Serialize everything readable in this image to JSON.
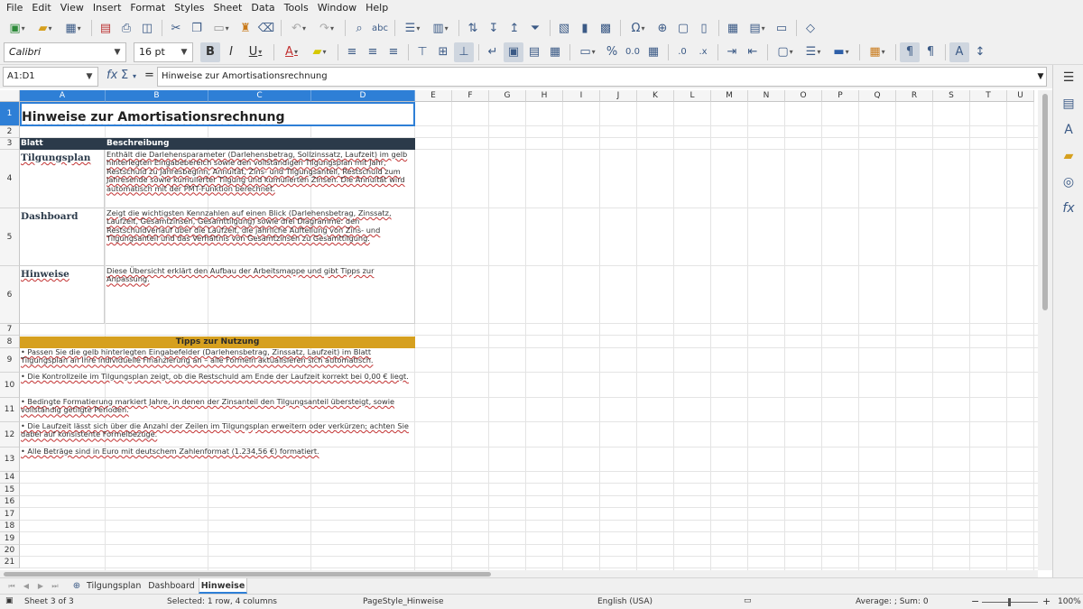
{
  "menu": [
    "File",
    "Edit",
    "View",
    "Insert",
    "Format",
    "Styles",
    "Sheet",
    "Data",
    "Tools",
    "Window",
    "Help"
  ],
  "font": {
    "name": "Calibri",
    "size": "16 pt"
  },
  "namebox": "A1:D1",
  "formula": "Hinweise zur Amortisationsrechnung",
  "formula_symbols": {
    "fx": "fx",
    "sum": "Σ",
    "equals": "="
  },
  "columns": [
    "A",
    "B",
    "C",
    "D",
    "E",
    "F",
    "G",
    "H",
    "I",
    "J",
    "K",
    "L",
    "M",
    "N",
    "O",
    "P",
    "Q",
    "R",
    "S",
    "T",
    "U"
  ],
  "rows": [
    "1",
    "2",
    "3",
    "4",
    "5",
    "6",
    "7",
    "8",
    "9",
    "10",
    "11",
    "12",
    "13",
    "14",
    "15",
    "16",
    "17",
    "18",
    "19",
    "20",
    "21"
  ],
  "sheet": {
    "title": "Hinweise zur Amortisationsrechnung",
    "header": {
      "col1": "Blatt",
      "col2": "Beschreibung"
    },
    "entries": [
      {
        "name": "Tilgungsplan",
        "desc": "Enthält die Darlehensparameter (Darlehensbetrag, Sollzinssatz, Laufzeit) im gelb hinterlegten Eingabebereich sowie den vollständigen Tilgungsplan mit Jahr, Restschuld zu Jahresbeginn, Annuität, Zins- und Tilgungsanteil, Restschuld zum Jahresende sowie kumulierter Tilgung und kumulierten Zinsen. Die Annuität wird automatisch mit der PMT-Funktion berechnet."
      },
      {
        "name": "Dashboard",
        "desc": "Zeigt die wichtigsten Kennzahlen auf einen Blick (Darlehensbetrag, Zinssatz, Laufzeit, Gesamtzinsen, Gesamttilgung) sowie drei Diagramme: den Restschuldverlauf über die Laufzeit, die jährliche Aufteilung von Zins- und Tilgungsanteil und das Verhältnis von Gesamtzinsen zu Gesamttilgung."
      },
      {
        "name": "Hinweise",
        "desc": "Diese Übersicht erklärt den Aufbau der Arbeitsmappe und gibt Tipps zur Anpassung."
      }
    ],
    "tips_header": "Tipps zur Nutzung",
    "tips": [
      "• Passen Sie die gelb hinterlegten Eingabefelder (Darlehensbetrag, Zinssatz, Laufzeit) im Blatt Tilgungsplan an Ihre individuelle Finanzierung an – alle Formeln aktualisieren sich automatisch.",
      "• Die Kontrollzeile im Tilgungsplan zeigt, ob die Restschuld am Ende der Laufzeit korrekt bei 0,00 € liegt.",
      "• Bedingte Formatierung markiert Jahre, in denen der Zinsanteil den Tilgungsanteil übersteigt, sowie vollständig getilgte Perioden.",
      "• Die Laufzeit lässt sich über die Anzahl der Zeilen im Tilgungsplan erweitern oder verkürzen; achten Sie dabei auf konsistente Formelbezüge.",
      "• Alle Beträge sind in Euro mit deutschem Zahlenformat (1.234,56 €) formatiert."
    ]
  },
  "tabs": [
    "Tilgungsplan",
    "Dashboard",
    "Hinweise"
  ],
  "active_tab": "Hinweise",
  "status": {
    "sheet": "Sheet 3 of 3",
    "selection": "Selected: 1 row, 4 columns",
    "pagestyle": "PageStyle_Hinweise",
    "language": "English (USA)",
    "summary": "Average: ; Sum: 0",
    "zoom": "100%",
    "zoom_minus": "−",
    "zoom_plus": "+"
  },
  "colors": {
    "accent": "#2e7fd6",
    "header_bg": "#2b3a4a",
    "tips_bg": "#d6a01f"
  }
}
